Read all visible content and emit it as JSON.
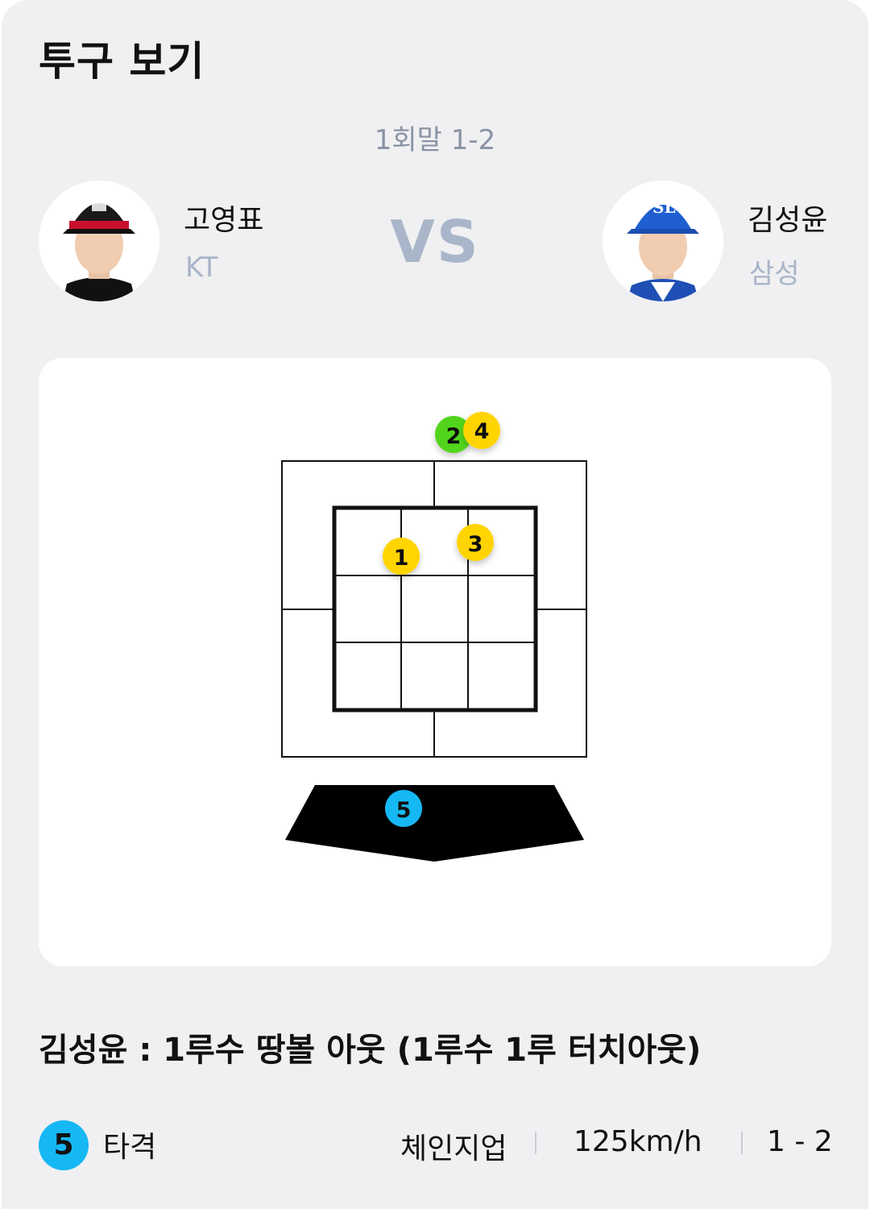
{
  "page": {
    "title": "투구 보기"
  },
  "game": {
    "inning_count": "1회말 1-2",
    "vs": "VS"
  },
  "pitcher": {
    "name": "고영표",
    "team": "KT"
  },
  "batter": {
    "name": "김성윤",
    "team": "삼성"
  },
  "pitches": [
    {
      "number": "1",
      "result": "strike",
      "color": "#ffd400"
    },
    {
      "number": "2",
      "result": "ball",
      "color": "#52d41a"
    },
    {
      "number": "3",
      "result": "strike",
      "color": "#ffd400"
    },
    {
      "number": "4",
      "result": "strike",
      "color": "#ffd400"
    },
    {
      "number": "5",
      "result": "in-play",
      "color": "#16b8f3"
    }
  ],
  "play": {
    "description": "김성윤 : 1루수 땅볼 아웃 (1루수 1루 터치아웃)"
  },
  "last_pitch": {
    "number": "5",
    "label": "타격",
    "type": "체인지업",
    "speed": "125km/h",
    "count": "1 - 2"
  },
  "colors": {
    "strike": "#ffd400",
    "ball": "#52d41a",
    "in_play": "#16b8f3",
    "accent_text": "#a9b6c9"
  }
}
